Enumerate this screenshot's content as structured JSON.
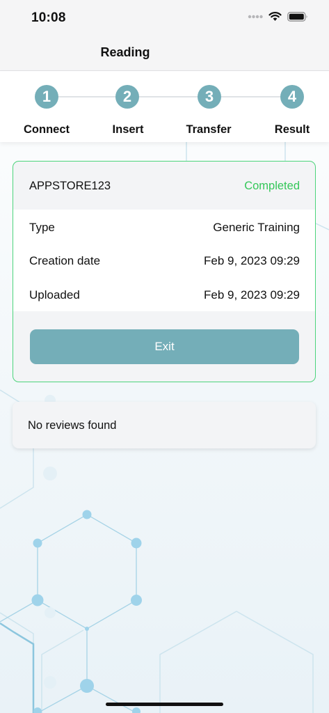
{
  "status_bar": {
    "time": "10:08"
  },
  "nav": {
    "title": "Reading"
  },
  "stepper": {
    "steps": [
      {
        "number": "1",
        "label": "Connect"
      },
      {
        "number": "2",
        "label": "Insert"
      },
      {
        "number": "3",
        "label": "Transfer"
      },
      {
        "number": "4",
        "label": "Result"
      }
    ]
  },
  "result_card": {
    "code": "APPSTORE123",
    "status": "Completed",
    "rows": [
      {
        "label": "Type",
        "value": "Generic Training"
      },
      {
        "label": "Creation date",
        "value": "Feb 9, 2023 09:29"
      },
      {
        "label": "Uploaded",
        "value": "Feb 9, 2023 09:29"
      }
    ],
    "exit_label": "Exit"
  },
  "reviews": {
    "empty_text": "No reviews found"
  },
  "colors": {
    "accent": "#74aeb8",
    "success": "#34c759",
    "border_success": "#4cd47b"
  }
}
